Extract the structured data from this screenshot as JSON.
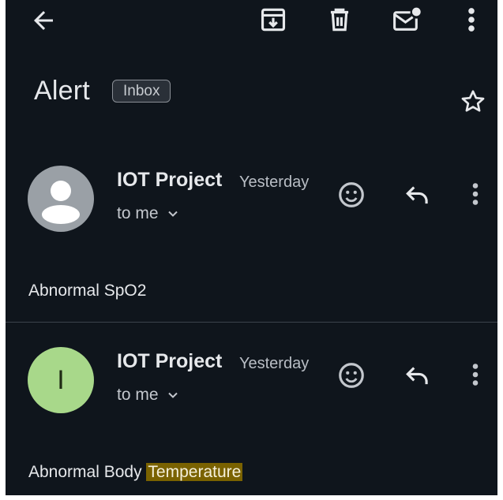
{
  "toolbar": {
    "back_icon": "arrow-left-icon",
    "archive_icon": "archive-icon",
    "delete_icon": "trash-icon",
    "mark_unread_icon": "mail-unread-icon",
    "more_icon": "more-vertical-icon"
  },
  "header": {
    "subject": "Alert",
    "label": "Inbox",
    "star_icon": "star-outline-icon"
  },
  "messages": [
    {
      "sender": "IOT Project",
      "time": "Yesterday",
      "recipient": "to me",
      "avatar_initial": "",
      "avatar_color": "#9aa0a6",
      "body": "Abnormal SpO2",
      "body_highlight": ""
    },
    {
      "sender": "IOT Project",
      "time": "Yesterday",
      "recipient": "to me",
      "avatar_initial": "I",
      "avatar_color": "#a8d88a",
      "body": "Abnormal Body ",
      "body_highlight": "Temperature"
    }
  ],
  "colors": {
    "background": "#0f151c",
    "text": "#e6e8eb",
    "highlight": "#7a6200"
  }
}
